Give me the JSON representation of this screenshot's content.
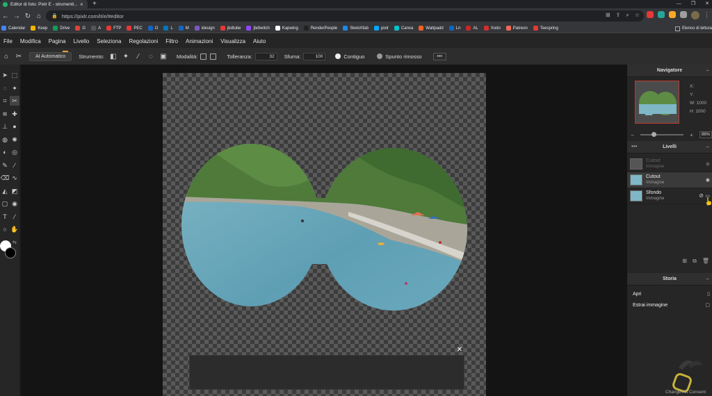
{
  "browser": {
    "tab_title": "Editor di foto: Pixlr E - strumenti...",
    "url": "https://pixlr.com/it/e/#editor",
    "bookmarks": [
      "Calendar",
      "Keep",
      "Drive",
      "G",
      "A",
      "FTP",
      "PEC",
      "O",
      "L",
      "M",
      "idesign",
      "jbdtube",
      "jbdtwitch",
      "Kapwing",
      "RenderPeople",
      "Sketchfab",
      "pixlr",
      "Canva",
      "Wattpadd",
      "Ln",
      "AL",
      "Xodo",
      "Patreon",
      "Teespring"
    ],
    "bookmark_colors": [
      "#4285f4",
      "#f4b400",
      "#0f9d58",
      "#db4437",
      "#555",
      "#e53935",
      "#e53935",
      "#1565c0",
      "#0277bd",
      "#1565c0",
      "#7e57c2",
      "#e53935",
      "#9146ff",
      "#fff",
      "#222",
      "#1e88e5",
      "#00a8ff",
      "#00c4cc",
      "#ff6122",
      "#0a66c2",
      "#c62828",
      "#d32f2f",
      "#f96854",
      "#e53935"
    ],
    "other_bookmarks": "Elenco di lettura"
  },
  "menu": [
    "File",
    "Modifica",
    "Pagina",
    "Livello",
    "Seleziona",
    "Regolazioni",
    "Filtro",
    "Animazioni",
    "Visualizza",
    "Aiuto"
  ],
  "options": {
    "auto_button": "AI Automatico",
    "tool_label": "Strumento:",
    "mode_label": "Modalità:",
    "tolerance_label": "Tolleranza:",
    "tolerance_value": "32",
    "feather_label": "Sfuma:",
    "feather_value": "100",
    "contiguous_label": "Contiguo",
    "removed_label": "Spunto rimosso",
    "more": "•••"
  },
  "navigator": {
    "title": "Navigatore",
    "x_label": "X:",
    "y_label": "Y:",
    "w_label": "W:",
    "w_value": "1000",
    "h_label": "H:",
    "h_value": "1000",
    "zoom": "86%"
  },
  "layers": {
    "title": "Livelli",
    "items": [
      {
        "name": "Cutout",
        "sub": "Immagine",
        "state": "dim"
      },
      {
        "name": "Cutout",
        "sub": "Immagine",
        "state": "selected"
      },
      {
        "name": "Sfondo",
        "sub": "Immagine",
        "state": "normal"
      }
    ]
  },
  "history": {
    "title": "Storia",
    "items": [
      "Apri",
      "Estrai immagine"
    ]
  },
  "footer": {
    "consent": "Change Ad Consent"
  }
}
